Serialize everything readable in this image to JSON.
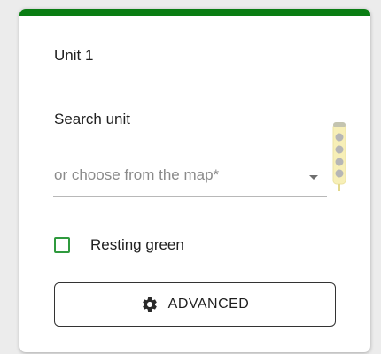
{
  "card": {
    "unit_title": "Unit 1",
    "search_label": "Search unit",
    "select_placeholder": "or choose from the map*",
    "resting_green_label": "Resting green",
    "advanced_label": "ADVANCED"
  },
  "icons": {
    "traffic_light": "traffic-light-icon",
    "gear": "gear-icon",
    "dropdown": "chevron-down-icon"
  },
  "colors": {
    "accent": "#0a7d13",
    "checkbox": "#2f9a3e",
    "traffic_light_body": "#f8f0b8",
    "traffic_light_lens": "#b6b6b6"
  }
}
